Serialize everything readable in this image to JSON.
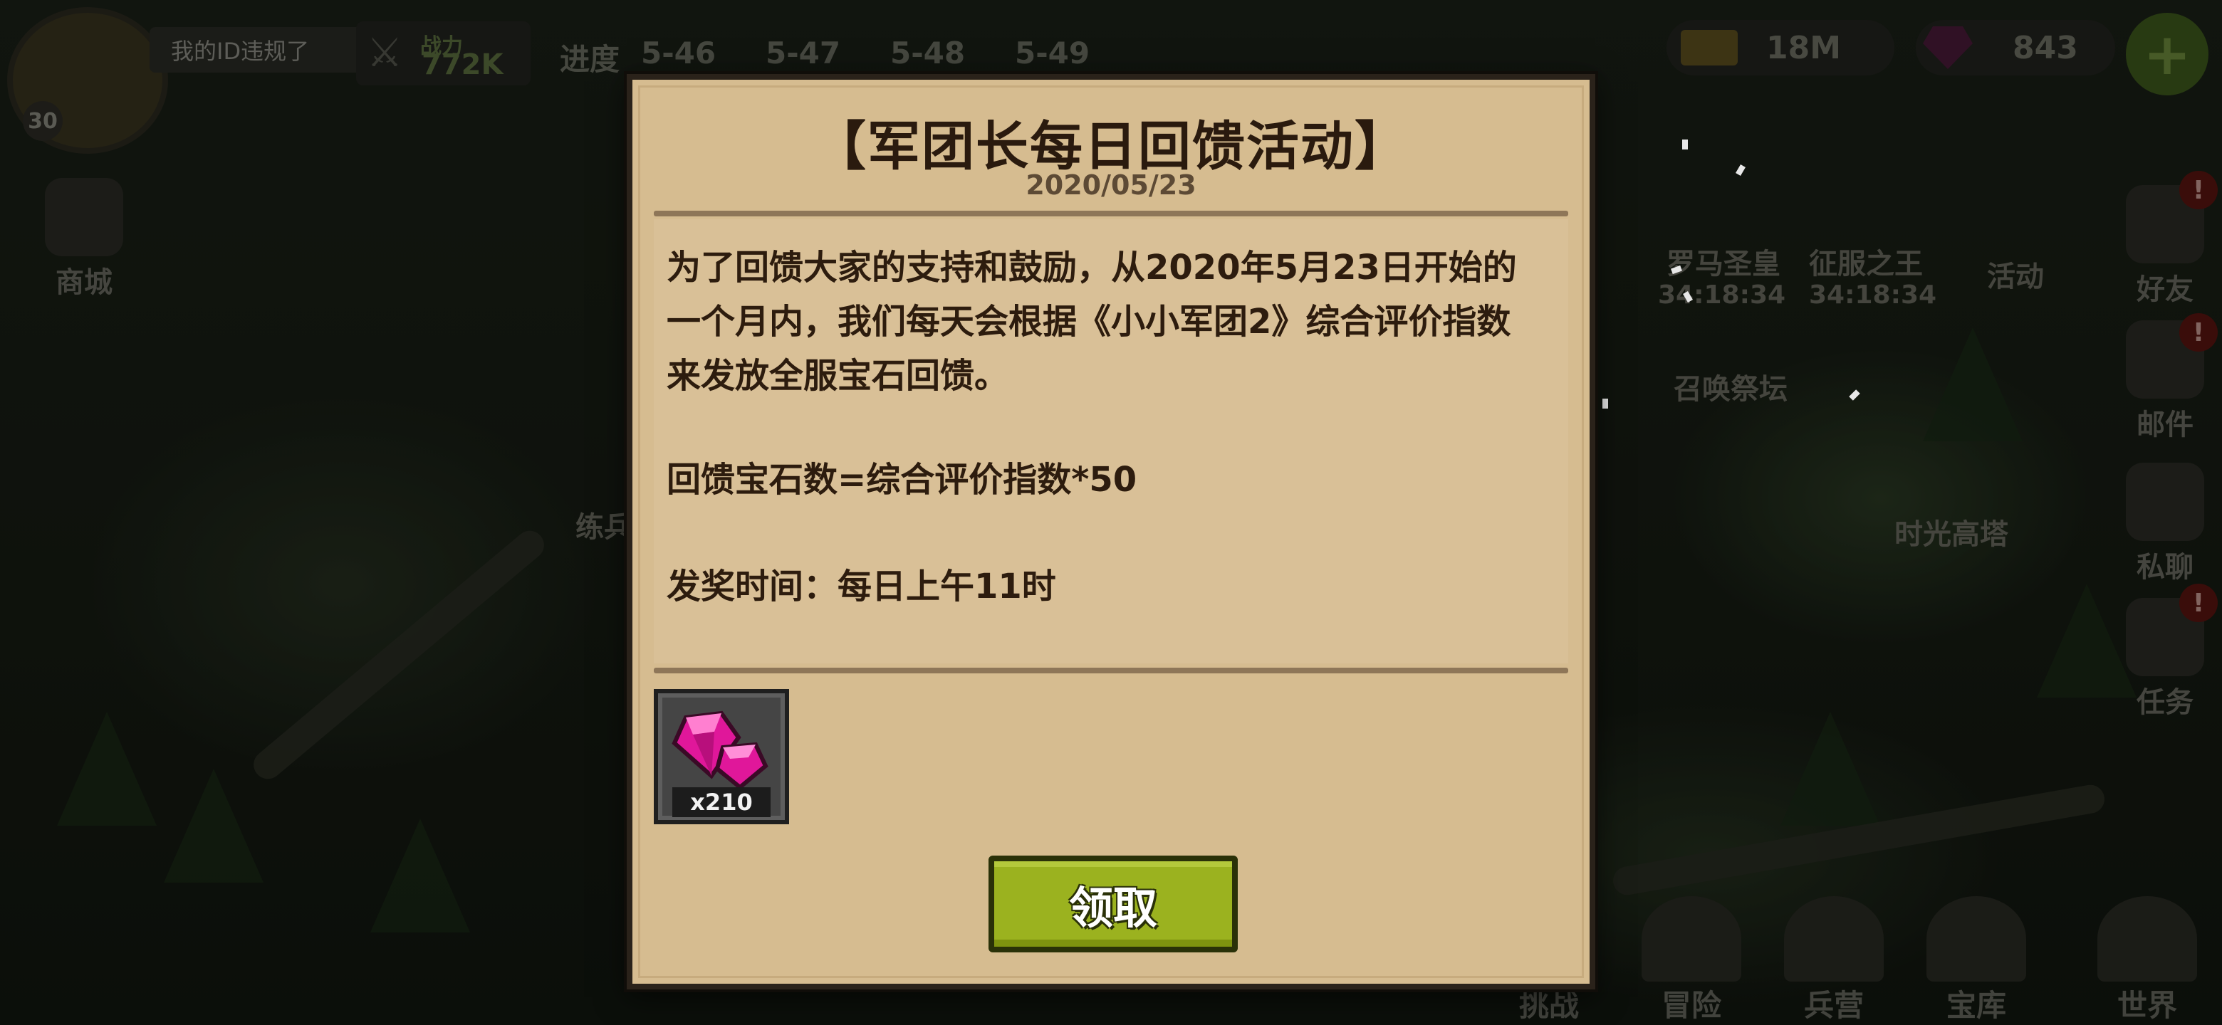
{
  "hud": {
    "player_level": "30",
    "player_id": "我的ID违规了",
    "power_label": "战力",
    "power_value": "772K",
    "progress_label": "进度",
    "progress_stages": [
      "5-46",
      "5-47",
      "5-48",
      "5-49"
    ],
    "gold": "18M",
    "gems": "843",
    "plus": "+"
  },
  "left_menu": {
    "shop": "商城"
  },
  "right_menu": {
    "friends": "好友",
    "mail": "邮件",
    "chat": "私聊",
    "tasks": "任务",
    "alert_mark": "!"
  },
  "map": {
    "roman_emperor": "罗马圣皇",
    "conqueror": "征服之王",
    "activity": "活动",
    "timer_1": "34:18:34",
    "timer_2": "34:18:34",
    "summon_altar": "召唤祭坛",
    "time_tower": "时光高塔",
    "left_label": "练兵"
  },
  "bottom_nav": {
    "challenge": "挑战",
    "adventure": "冒险",
    "barracks": "兵营",
    "treasury": "宝库",
    "world": "世界"
  },
  "dialog": {
    "title": "【军团长每日回馈活动】",
    "date": "2020/05/23",
    "paragraph_1_line_1": "为了回馈大家的支持和鼓励，从2020年5月23日开始的",
    "paragraph_1_line_2": "一个月内，我们每天会根据《小小军团2》综合评价指数",
    "paragraph_1_line_3": "来发放全服宝石回馈。",
    "formula": "回馈宝石数=综合评价指数*50",
    "award_time": "发奖时间：每日上午11时",
    "reward": {
      "icon": "gem-icon",
      "count": "x210"
    },
    "claim_button": "领取"
  },
  "colors": {
    "dialog_bg": "#d6bc90",
    "claim_button": "#9bb21f",
    "gem": "#e6199b",
    "title_text": "#2a1a0e"
  }
}
